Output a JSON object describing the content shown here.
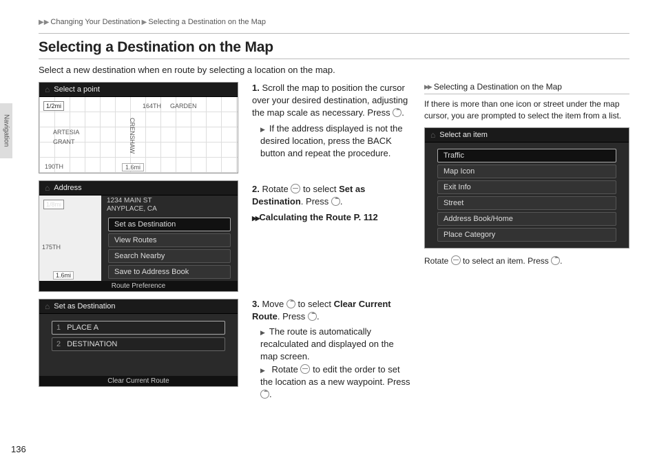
{
  "breadcrumb": {
    "a": "Changing Your Destination",
    "b": "Selecting a Destination on the Map"
  },
  "title": "Selecting a Destination on the Map",
  "intro": "Select a new destination when en route by selecting a location on the map.",
  "section_tab": "Navigation",
  "page_number": "136",
  "steps": {
    "s1": "Scroll the map to position the cursor over your desired destination, adjusting the map scale as necessary. Press",
    "s1_end": ".",
    "s1_sub1": "If the address displayed is not the desired location, press the BACK button and repeat the procedure.",
    "s2a": "Rotate",
    "s2b": "to select",
    "s2_bold": "Set as Destination",
    "s2c": ". Press",
    "s2_end": ".",
    "s2_ref": "Calculating the Route",
    "s2_ref_page": "P. 112",
    "s3a": "Move",
    "s3b": "to select",
    "s3_bold": "Clear Current Route",
    "s3c": ". Press",
    "s3_end": ".",
    "s3_sub1": "The route is automatically recalculated and displayed on the map screen.",
    "s3_sub2a": "Rotate",
    "s3_sub2b": "to edit the order to set the location as a new waypoint. Press",
    "s3_sub2_end": "."
  },
  "shots": {
    "shot1": {
      "bar": "Select a point",
      "scale": "1/2mi",
      "dist": "1.6mi",
      "street1": "164TH",
      "street2": "GARDEN",
      "street3": "ARTESIA",
      "street4": "GRANT",
      "street5": "CRENSHAW",
      "street6": "190TH"
    },
    "shot2": {
      "bar": "Address",
      "addr1": "1234 MAIN ST",
      "addr2": "ANYPLACE, CA",
      "m1": "Set as Destination",
      "m2": "View Routes",
      "m3": "Search Nearby",
      "m4": "Save to Address Book",
      "footer": "Route Preference",
      "scale": "1/8mi",
      "dist": "1.6mi",
      "side_street": "175TH"
    },
    "shot3": {
      "bar": "Set as Destination",
      "r1_tag": "1",
      "r1": "PLACE A",
      "r2_tag": "2",
      "r2": "DESTINATION",
      "footer": "Clear Current Route"
    },
    "shot4": {
      "bar": "Select an item",
      "i1": "Traffic",
      "i2": "Map Icon",
      "i3": "Exit Info",
      "i4": "Street",
      "i5": "Address Book/Home",
      "i6": "Place Category"
    }
  },
  "sidebar": {
    "heading": "Selecting a Destination on the Map",
    "text": "If there is more than one icon or street under the map cursor, you are prompted to select the item from a list.",
    "hint_a": "Rotate",
    "hint_b": "to select an item. Press",
    "hint_end": "."
  }
}
